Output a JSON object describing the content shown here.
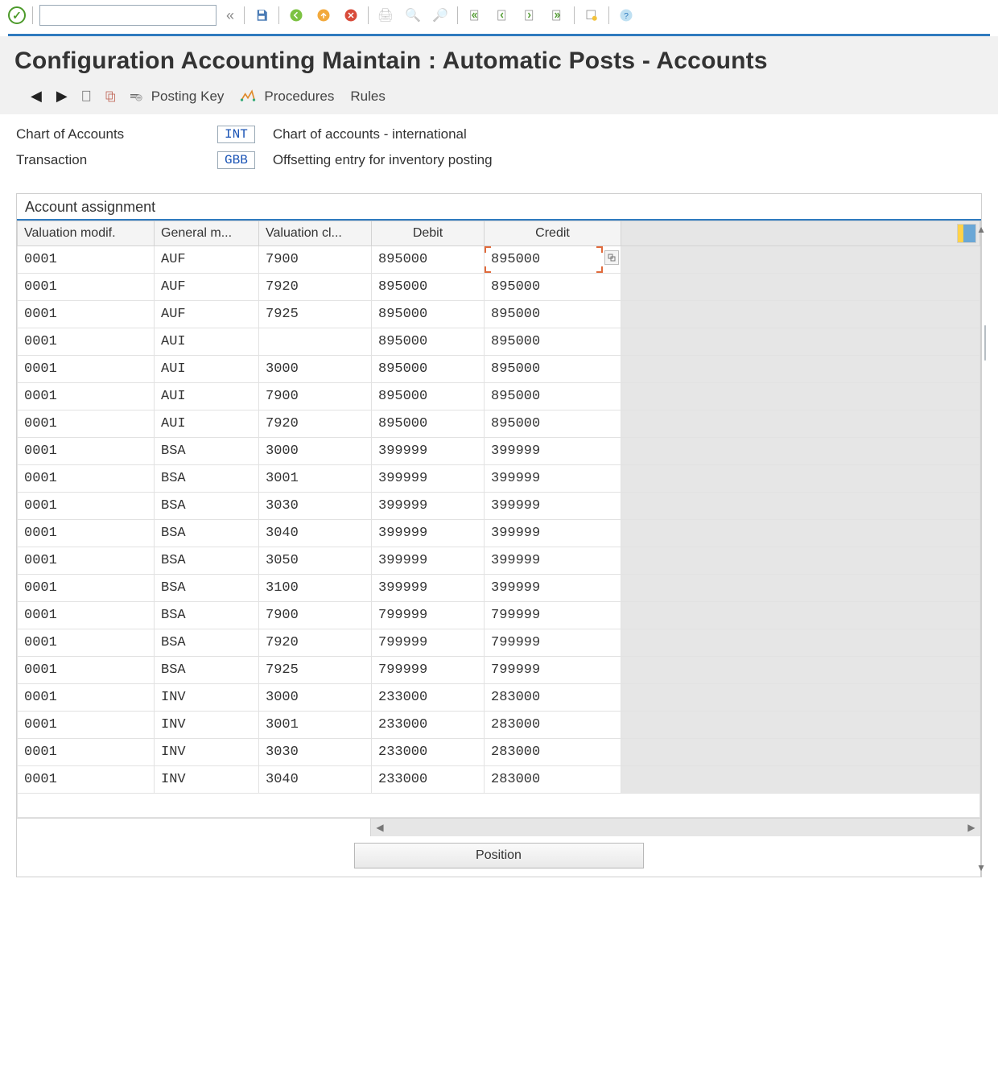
{
  "page_title": "Configuration Accounting Maintain : Automatic Posts - Accounts",
  "app_toolbar": {
    "posting_key": "Posting Key",
    "procedures": "Procedures",
    "rules": "Rules"
  },
  "header": {
    "coa_label": "Chart of Accounts",
    "coa_code": "INT",
    "coa_desc": "Chart of accounts - international",
    "trx_label": "Transaction",
    "trx_code": "GBB",
    "trx_desc": "Offsetting entry for inventory posting"
  },
  "panel_title": "Account assignment",
  "columns": {
    "c1": "Valuation modif.",
    "c2": "General m...",
    "c3": "Valuation cl...",
    "c4": "Debit",
    "c5": "Credit"
  },
  "rows": [
    {
      "vm": "0001",
      "gm": "AUF",
      "vc": "7900",
      "db": "895000",
      "cr": "895000"
    },
    {
      "vm": "0001",
      "gm": "AUF",
      "vc": "7920",
      "db": "895000",
      "cr": "895000"
    },
    {
      "vm": "0001",
      "gm": "AUF",
      "vc": "7925",
      "db": "895000",
      "cr": "895000"
    },
    {
      "vm": "0001",
      "gm": "AUI",
      "vc": "",
      "db": "895000",
      "cr": "895000"
    },
    {
      "vm": "0001",
      "gm": "AUI",
      "vc": "3000",
      "db": "895000",
      "cr": "895000"
    },
    {
      "vm": "0001",
      "gm": "AUI",
      "vc": "7900",
      "db": "895000",
      "cr": "895000"
    },
    {
      "vm": "0001",
      "gm": "AUI",
      "vc": "7920",
      "db": "895000",
      "cr": "895000"
    },
    {
      "vm": "0001",
      "gm": "BSA",
      "vc": "3000",
      "db": "399999",
      "cr": "399999"
    },
    {
      "vm": "0001",
      "gm": "BSA",
      "vc": "3001",
      "db": "399999",
      "cr": "399999"
    },
    {
      "vm": "0001",
      "gm": "BSA",
      "vc": "3030",
      "db": "399999",
      "cr": "399999"
    },
    {
      "vm": "0001",
      "gm": "BSA",
      "vc": "3040",
      "db": "399999",
      "cr": "399999"
    },
    {
      "vm": "0001",
      "gm": "BSA",
      "vc": "3050",
      "db": "399999",
      "cr": "399999"
    },
    {
      "vm": "0001",
      "gm": "BSA",
      "vc": "3100",
      "db": "399999",
      "cr": "399999"
    },
    {
      "vm": "0001",
      "gm": "BSA",
      "vc": "7900",
      "db": "799999",
      "cr": "799999"
    },
    {
      "vm": "0001",
      "gm": "BSA",
      "vc": "7920",
      "db": "799999",
      "cr": "799999"
    },
    {
      "vm": "0001",
      "gm": "BSA",
      "vc": "7925",
      "db": "799999",
      "cr": "799999"
    },
    {
      "vm": "0001",
      "gm": "INV",
      "vc": "3000",
      "db": "233000",
      "cr": "283000"
    },
    {
      "vm": "0001",
      "gm": "INV",
      "vc": "3001",
      "db": "233000",
      "cr": "283000"
    },
    {
      "vm": "0001",
      "gm": "INV",
      "vc": "3030",
      "db": "233000",
      "cr": "283000"
    },
    {
      "vm": "0001",
      "gm": "INV",
      "vc": "3040",
      "db": "233000",
      "cr": "283000"
    }
  ],
  "position_button": "Position",
  "command_value": ""
}
